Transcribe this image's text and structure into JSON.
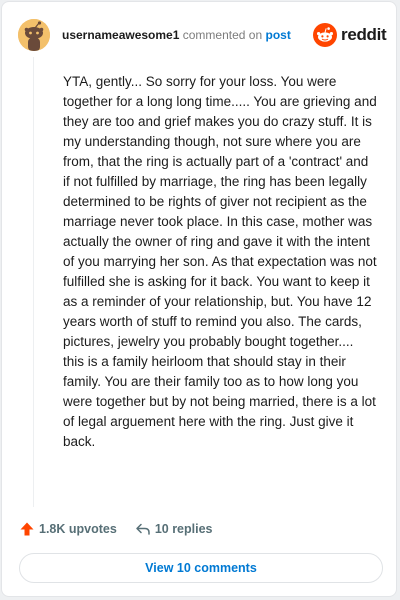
{
  "comment": {
    "username": "usernameawesome1",
    "action_text": "commented on",
    "post_link": "post",
    "body": "YTA, gently... So sorry for your loss. You were together for a long long time..... You are grieving and they are too and grief makes you do crazy stuff. It is my understanding though, not sure where you are from, that the ring is actually part of a 'contract' and if not fulfilled by marriage, the ring has been legally determined to be rights of giver not recipient as the marriage never took place. In this case, mother was actually the owner of ring and gave it with the intent of you marrying her son. As that expectation was not fulfilled she is asking for it back. You want to keep it as a reminder of your relationship, but. You have 12 years worth of stuff to remind you also. The cards, pictures, jewelry you probably bought together.... this is a family heirloom that should stay in their family. You are their family too as to how long you were together but by not being married, there is a lot of legal arguement here with the ring. Just give it back."
  },
  "brand": {
    "name": "reddit",
    "color": "#ff4500",
    "icon": "reddit-alien-icon"
  },
  "actions": {
    "upvotes": "1.8K upvotes",
    "upvote_icon": "upvote-arrow-icon",
    "upvote_color": "#ff4500",
    "replies": "10 replies",
    "reply_icon": "reply-arrow-icon"
  },
  "view_comments": {
    "label": "View 10 comments",
    "color": "#0079d3"
  },
  "colors": {
    "avatar_bg": "#f3c06b",
    "link": "#0079d3"
  }
}
